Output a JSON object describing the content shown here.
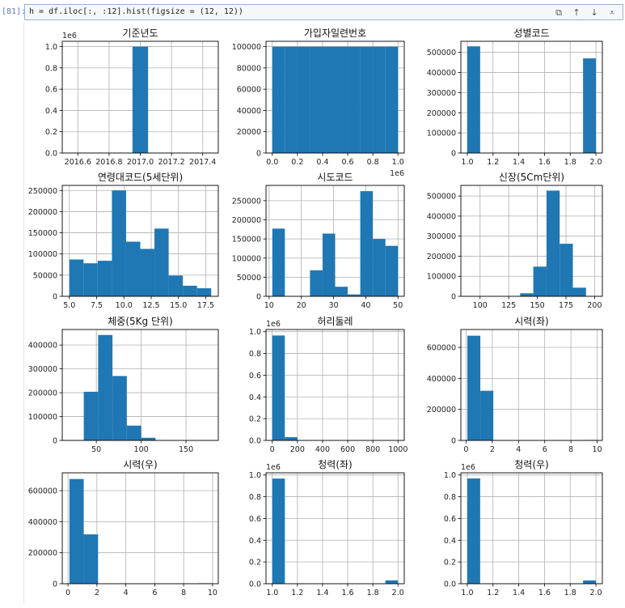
{
  "cell": {
    "prompt": "[81]:",
    "code": "h = df.iloc[:, :12].hist(figsize = (12, 12))",
    "toolbar_icons": [
      "copy-icon",
      "arrow-up-icon",
      "arrow-down-icon",
      "insert-below-icon"
    ]
  },
  "chart_data": [
    {
      "type": "bar",
      "title": "기준년도",
      "xlim": [
        2016.5,
        2017.5
      ],
      "xticks": [
        "2016.6",
        "2016.8",
        "2017.0",
        "2017.2",
        "2017.4"
      ],
      "xtick_values": [
        2016.6,
        2016.8,
        2017.0,
        2017.2,
        2017.4
      ],
      "ylim": [
        0,
        1.05
      ],
      "yticks": [
        "0.0",
        "0.2",
        "0.4",
        "0.6",
        "0.8",
        "1.0"
      ],
      "ytick_values": [
        0,
        0.2,
        0.4,
        0.6,
        0.8,
        1.0
      ],
      "y_offset_label": "1e6",
      "bins": [
        [
          2016.95,
          2017.05,
          1.0
        ]
      ]
    },
    {
      "type": "bar",
      "title": "가입자일련번호",
      "xlim": [
        -0.05,
        1.05
      ],
      "xticks": [
        "0.0",
        "0.2",
        "0.4",
        "0.6",
        "0.8",
        "1.0"
      ],
      "xtick_values": [
        0,
        0.2,
        0.4,
        0.6,
        0.8,
        1.0
      ],
      "x_offset_label": "1e6",
      "ylim": [
        0,
        105000
      ],
      "yticks": [
        "0",
        "20000",
        "40000",
        "60000",
        "80000",
        "100000"
      ],
      "ytick_values": [
        0,
        20000,
        40000,
        60000,
        80000,
        100000
      ],
      "bins": [
        [
          0,
          0.1,
          100000
        ],
        [
          0.1,
          0.2,
          100000
        ],
        [
          0.2,
          0.3,
          100000
        ],
        [
          0.3,
          0.4,
          100000
        ],
        [
          0.4,
          0.5,
          100000
        ],
        [
          0.5,
          0.6,
          100000
        ],
        [
          0.6,
          0.7,
          100000
        ],
        [
          0.7,
          0.8,
          100000
        ],
        [
          0.8,
          0.9,
          100000
        ],
        [
          0.9,
          1.0,
          100000
        ]
      ]
    },
    {
      "type": "bar",
      "title": "성별코드",
      "xlim": [
        0.95,
        2.05
      ],
      "xticks": [
        "1.0",
        "1.2",
        "1.4",
        "1.6",
        "1.8",
        "2.0"
      ],
      "xtick_values": [
        1.0,
        1.2,
        1.4,
        1.6,
        1.8,
        2.0
      ],
      "ylim": [
        0,
        555000
      ],
      "yticks": [
        "0",
        "100000",
        "200000",
        "300000",
        "400000",
        "500000"
      ],
      "ytick_values": [
        0,
        100000,
        200000,
        300000,
        400000,
        500000
      ],
      "bins": [
        [
          1.0,
          1.1,
          530000
        ],
        [
          1.9,
          2.0,
          470000
        ]
      ]
    },
    {
      "type": "bar",
      "title": "연령대코드(5세단위)",
      "xlim": [
        4.35,
        18.65
      ],
      "xticks": [
        "5.0",
        "7.5",
        "10.0",
        "12.5",
        "15.0",
        "17.5"
      ],
      "xtick_values": [
        5,
        7.5,
        10,
        12.5,
        15,
        17.5
      ],
      "ylim": [
        0,
        262000
      ],
      "yticks": [
        "0",
        "50000",
        "100000",
        "150000",
        "200000",
        "250000"
      ],
      "ytick_values": [
        0,
        50000,
        100000,
        150000,
        200000,
        250000
      ],
      "bins": [
        [
          5,
          6.3,
          87000
        ],
        [
          6.3,
          7.6,
          78000
        ],
        [
          7.6,
          8.9,
          84000
        ],
        [
          8.9,
          10.2,
          250000
        ],
        [
          10.2,
          11.5,
          129000
        ],
        [
          11.5,
          12.8,
          112000
        ],
        [
          12.8,
          14.1,
          160000
        ],
        [
          14.1,
          15.4,
          49000
        ],
        [
          15.4,
          16.7,
          25000
        ],
        [
          16.7,
          18,
          19000
        ]
      ]
    },
    {
      "type": "bar",
      "title": "시도코드",
      "xlim": [
        9.05,
        51.95
      ],
      "xticks": [
        "10",
        "20",
        "30",
        "40",
        "50"
      ],
      "xtick_values": [
        10,
        20,
        30,
        40,
        50
      ],
      "ylim": [
        0,
        290000
      ],
      "yticks": [
        "0",
        "50000",
        "100000",
        "150000",
        "200000",
        "250000"
      ],
      "ytick_values": [
        0,
        50000,
        100000,
        150000,
        200000,
        250000
      ],
      "bins": [
        [
          11,
          14.9,
          177000
        ],
        [
          14.9,
          18.8,
          0
        ],
        [
          18.8,
          22.7,
          0
        ],
        [
          22.7,
          26.6,
          68000
        ],
        [
          26.6,
          30.5,
          164000
        ],
        [
          30.5,
          34.4,
          25000
        ],
        [
          34.4,
          38.3,
          5000
        ],
        [
          38.3,
          42.2,
          275000
        ],
        [
          42.2,
          46.1,
          150000
        ],
        [
          46.1,
          50,
          132000
        ]
      ]
    },
    {
      "type": "bar",
      "title": "신장(5Cm단위)",
      "xlim": [
        83.25,
        206.75
      ],
      "xticks": [
        "100",
        "125",
        "150",
        "175",
        "200"
      ],
      "xtick_values": [
        100,
        125,
        150,
        175,
        200
      ],
      "ylim": [
        0,
        553000
      ],
      "yticks": [
        "0",
        "100000",
        "200000",
        "300000",
        "400000",
        "500000"
      ],
      "ytick_values": [
        0,
        100000,
        200000,
        300000,
        400000,
        500000
      ],
      "bins": [
        [
          89,
          100.5,
          200
        ],
        [
          100.5,
          112,
          300
        ],
        [
          112,
          123.5,
          800
        ],
        [
          123.5,
          135,
          2000
        ],
        [
          135,
          146.5,
          15000
        ],
        [
          146.5,
          158,
          148000
        ],
        [
          158,
          169.5,
          527000
        ],
        [
          169.5,
          181,
          262000
        ],
        [
          181,
          192.5,
          43000
        ],
        [
          192.5,
          204,
          800
        ]
      ]
    },
    {
      "type": "bar",
      "title": "체중(5Kg 단위)",
      "xlim": [
        12.0,
        186.0
      ],
      "xticks": [
        "50",
        "100",
        "150"
      ],
      "xtick_values": [
        50,
        100,
        150
      ],
      "ylim": [
        0,
        465000
      ],
      "yticks": [
        "0",
        "100000",
        "200000",
        "300000",
        "400000"
      ],
      "ytick_values": [
        0,
        100000,
        200000,
        300000,
        400000
      ],
      "bins": [
        [
          20,
          36,
          400
        ],
        [
          36,
          52,
          204000
        ],
        [
          52,
          68,
          442000
        ],
        [
          68,
          84,
          270000
        ],
        [
          84,
          100,
          62000
        ],
        [
          100,
          116,
          11000
        ],
        [
          116,
          132,
          1500
        ],
        [
          132,
          148,
          400
        ],
        [
          148,
          164,
          200
        ],
        [
          164,
          180,
          100
        ]
      ]
    },
    {
      "type": "bar",
      "title": "허리둘레",
      "xlim": [
        -49.5,
        1049.5
      ],
      "xticks": [
        "0",
        "200",
        "400",
        "600",
        "800",
        "1000"
      ],
      "xtick_values": [
        0,
        200,
        400,
        600,
        800,
        1000
      ],
      "ylim": [
        0,
        1.02
      ],
      "yticks": [
        "0.0",
        "0.2",
        "0.4",
        "0.6",
        "0.8",
        "1.0"
      ],
      "ytick_values": [
        0,
        0.2,
        0.4,
        0.6,
        0.8,
        1.0
      ],
      "y_offset_label": "1e6",
      "bins": [
        [
          0,
          100,
          0.965
        ],
        [
          100,
          200,
          0.03
        ],
        [
          200,
          300,
          0.001
        ],
        [
          300,
          400,
          0
        ],
        [
          400,
          500,
          0
        ],
        [
          500,
          600,
          0
        ],
        [
          600,
          700,
          0
        ],
        [
          700,
          800,
          0
        ],
        [
          800,
          900,
          0
        ],
        [
          900,
          1000,
          0.001
        ]
      ]
    },
    {
      "type": "bar",
      "title": "시력(좌)",
      "xlim": [
        -0.395,
        10.395
      ],
      "xticks": [
        "0",
        "2",
        "4",
        "6",
        "8",
        "10"
      ],
      "xtick_values": [
        0,
        2,
        4,
        6,
        8,
        10
      ],
      "ylim": [
        0,
        715000
      ],
      "yticks": [
        "0",
        "200000",
        "400000",
        "600000"
      ],
      "ytick_values": [
        0,
        200000,
        400000,
        600000
      ],
      "bins": [
        [
          0.1,
          1.09,
          675000
        ],
        [
          1.09,
          2.08,
          320000
        ],
        [
          2.08,
          3.07,
          0
        ],
        [
          3.07,
          4.06,
          0
        ],
        [
          4.06,
          5.05,
          0
        ],
        [
          5.05,
          6.04,
          0
        ],
        [
          6.04,
          7.03,
          0
        ],
        [
          7.03,
          8.02,
          0
        ],
        [
          8.02,
          9.01,
          0
        ],
        [
          9.01,
          10,
          3000
        ]
      ]
    },
    {
      "type": "bar",
      "title": "시력(우)",
      "xlim": [
        -0.395,
        10.395
      ],
      "xticks": [
        "0",
        "2",
        "4",
        "6",
        "8",
        "10"
      ],
      "xtick_values": [
        0,
        2,
        4,
        6,
        8,
        10
      ],
      "ylim": [
        0,
        715000
      ],
      "yticks": [
        "0",
        "200000",
        "400000",
        "600000"
      ],
      "ytick_values": [
        0,
        200000,
        400000,
        600000
      ],
      "bins": [
        [
          0.1,
          1.09,
          675000
        ],
        [
          1.09,
          2.08,
          318000
        ],
        [
          2.08,
          3.07,
          0
        ],
        [
          3.07,
          4.06,
          0
        ],
        [
          4.06,
          5.05,
          0
        ],
        [
          5.05,
          6.04,
          0
        ],
        [
          6.04,
          7.03,
          0
        ],
        [
          7.03,
          8.02,
          0
        ],
        [
          8.02,
          9.01,
          0
        ],
        [
          9.01,
          10,
          3000
        ]
      ]
    },
    {
      "type": "bar",
      "title": "청력(좌)",
      "xlim": [
        0.95,
        2.05
      ],
      "xticks": [
        "1.0",
        "1.2",
        "1.4",
        "1.6",
        "1.8",
        "2.0"
      ],
      "xtick_values": [
        1.0,
        1.2,
        1.4,
        1.6,
        1.8,
        2.0
      ],
      "ylim": [
        0,
        1.02
      ],
      "yticks": [
        "0.0",
        "0.2",
        "0.4",
        "0.6",
        "0.8",
        "1.0"
      ],
      "ytick_values": [
        0,
        0.2,
        0.4,
        0.6,
        0.8,
        1.0
      ],
      "y_offset_label": "1e6",
      "bins": [
        [
          1.0,
          1.1,
          0.967
        ],
        [
          1.9,
          2.0,
          0.031
        ]
      ]
    },
    {
      "type": "bar",
      "title": "청력(우)",
      "xlim": [
        0.95,
        2.05
      ],
      "xticks": [
        "1.0",
        "1.2",
        "1.4",
        "1.6",
        "1.8",
        "2.0"
      ],
      "xtick_values": [
        1.0,
        1.2,
        1.4,
        1.6,
        1.8,
        2.0
      ],
      "ylim": [
        0,
        1.02
      ],
      "yticks": [
        "0.0",
        "0.2",
        "0.4",
        "0.6",
        "0.8",
        "1.0"
      ],
      "ytick_values": [
        0,
        0.2,
        0.4,
        0.6,
        0.8,
        1.0
      ],
      "y_offset_label": "1e6",
      "bins": [
        [
          1.0,
          1.1,
          0.968
        ],
        [
          1.9,
          2.0,
          0.03
        ]
      ]
    }
  ],
  "style": {
    "bar_color": "#1f77b4",
    "grid_color": "#b0b0b0",
    "axis_color": "#000000"
  }
}
